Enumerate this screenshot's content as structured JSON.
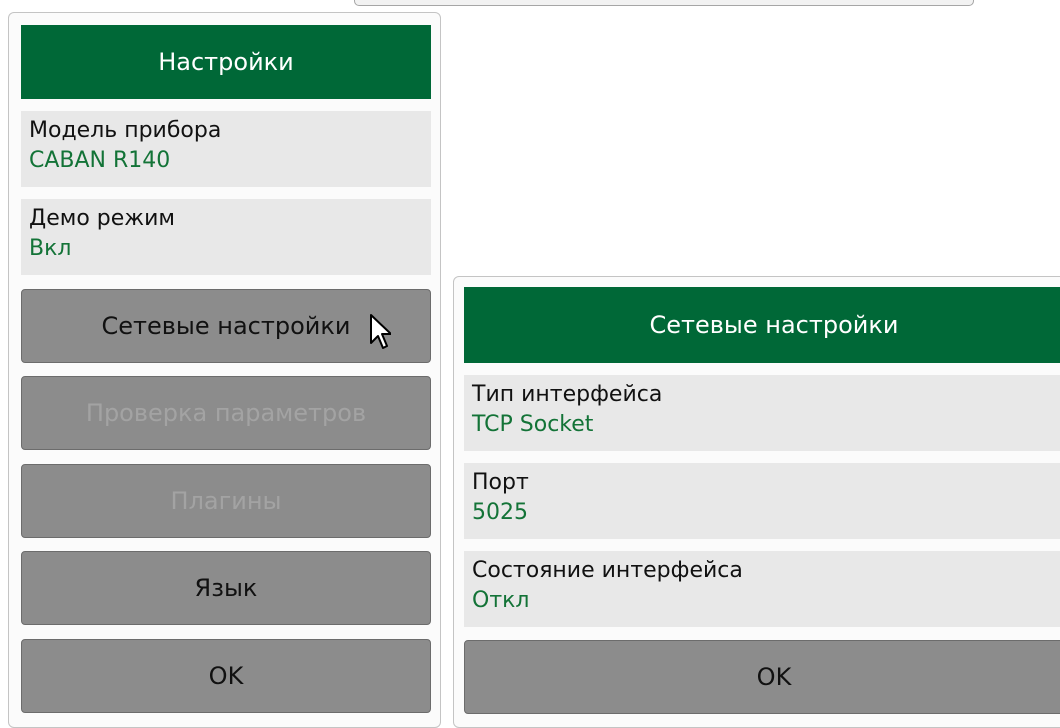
{
  "settings_dialog": {
    "title": "Настройки",
    "device_model": {
      "label": "Модель прибора",
      "value": "CABAN R140"
    },
    "demo_mode": {
      "label": "Демо режим",
      "value": "Вкл"
    },
    "buttons": {
      "network_settings": "Сетевые настройки",
      "parameter_check": "Проверка параметров",
      "plugins": "Плагины",
      "language": "Язык",
      "ok": "OK"
    }
  },
  "network_dialog": {
    "title": "Сетевые настройки",
    "interface_type": {
      "label": "Тип интерфейса",
      "value": "TCP Socket"
    },
    "port": {
      "label": "Порт",
      "value": "5025"
    },
    "interface_state": {
      "label": "Состояние интерфейса",
      "value": "Откл"
    },
    "ok": "OK"
  },
  "icons": {
    "cursor": "mouse-pointer-icon"
  },
  "colors": {
    "header_green": "#006837",
    "value_green": "#137337",
    "field_bg": "#e8e8e8",
    "button_bg": "#8c8c8c",
    "disabled_text": "#a3a3a3"
  }
}
